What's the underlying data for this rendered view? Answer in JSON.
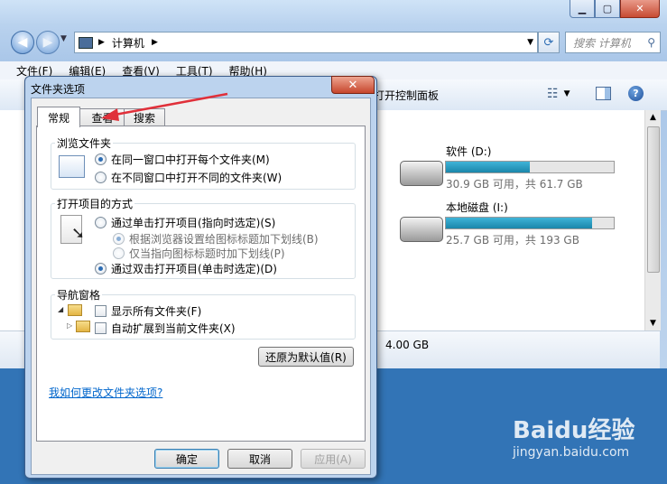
{
  "window": {
    "address_segments": [
      "计算机"
    ],
    "search_placeholder": "搜索 计算机",
    "menu": [
      "文件(F)",
      "编辑(E)",
      "查看(V)",
      "工具(T)",
      "帮助(H)"
    ],
    "toolbar_label": "打开控制面板"
  },
  "drives": [
    {
      "name": "软件 (D:)",
      "usage": "30.9 GB 可用，共 61.7 GB",
      "used_fraction": 0.5
    },
    {
      "name": "本地磁盘 (I:)",
      "usage": "25.7 GB 可用，共 193 GB",
      "used_fraction": 0.87
    }
  ],
  "details_text": "4.00 GB",
  "dialog": {
    "title": "文件夹选项",
    "tabs": [
      "常规",
      "查看",
      "搜索"
    ],
    "browse_group": {
      "label": "浏览文件夹",
      "options": [
        "在同一窗口中打开每个文件夹(M)",
        "在不同窗口中打开不同的文件夹(W)"
      ],
      "selected": 0
    },
    "click_group": {
      "label": "打开项目的方式",
      "single_click": "通过单击打开项目(指向时选定)(S)",
      "sub_options": [
        "根据浏览器设置给图标标题加下划线(B)",
        "仅当指向图标标题时加下划线(P)"
      ],
      "double_click": "通过双击打开项目(单击时选定)(D)",
      "selected": "double_click"
    },
    "nav_group": {
      "label": "导航窗格",
      "options": [
        "显示所有文件夹(F)",
        "自动扩展到当前文件夹(X)"
      ]
    },
    "restore_button": "还原为默认值(R)",
    "help_link": "我如何更改文件夹选项?",
    "ok_button": "确定",
    "cancel_button": "取消",
    "apply_button": "应用(A)"
  },
  "watermark": {
    "brand": "Baidu经验",
    "url": "jingyan.baidu.com"
  },
  "colors": {
    "accent": "#2c6cb3",
    "link": "#0066cc",
    "annotation_arrow": "#e0303a",
    "drive_bar": "#1a86aa"
  }
}
